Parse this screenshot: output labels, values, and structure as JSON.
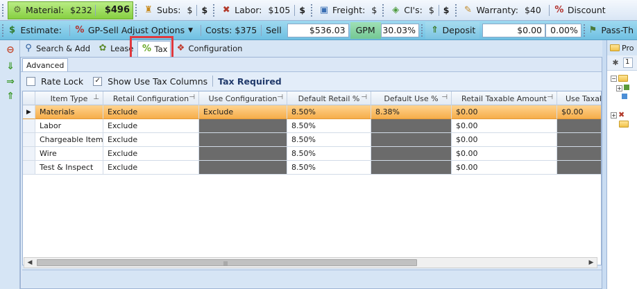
{
  "toolbar1": {
    "material": {
      "label": "Material:",
      "value": "$232",
      "total": "$496"
    },
    "subs": {
      "label": "Subs:",
      "value": "$",
      "total": "$"
    },
    "labor": {
      "label": "Labor:",
      "value": "$105",
      "total": "$"
    },
    "freight": {
      "label": "Freight:",
      "value": "$",
      "total": "$"
    },
    "cis": {
      "label": "CI's:",
      "value": "$",
      "total": "$"
    },
    "warranty": {
      "label": "Warranty:",
      "value": "$40"
    },
    "discount": {
      "label": "Discount"
    }
  },
  "toolbar2": {
    "estimate_label": "Estimate:",
    "gp_sell_label": "GP-Sell Adjust Options",
    "costs_label": "Costs: $375",
    "sell_label": "Sell",
    "sell_value": "$536.03",
    "gpm_label": "GPM",
    "gpm_value": "30.03%",
    "deposit_label": "Deposit",
    "deposit_value": "$0.00",
    "deposit_pct": "0.00%",
    "pass_through_label": "Pass-Th"
  },
  "tabs": [
    {
      "label": "Search & Add",
      "icon": "search-icon"
    },
    {
      "label": "Lease",
      "icon": "lease-icon"
    },
    {
      "label": "Tax",
      "icon": "percent-icon",
      "active": true
    },
    {
      "label": "Configuration",
      "icon": "configuration-icon"
    }
  ],
  "subtab": "Advanced",
  "options": {
    "rate_lock": {
      "label": "Rate Lock",
      "checked": false
    },
    "show_use_tax": {
      "label": "Show Use Tax Columns",
      "checked": true
    },
    "tax_required": "Tax Required"
  },
  "grid": {
    "columns": [
      "Item Type",
      "Retail Configuration",
      "Use Configuration",
      "Default Retail %",
      "Default Use %",
      "Retail Taxable Amount",
      "Use Taxab"
    ],
    "rows": [
      {
        "cells": [
          "Materials",
          "Exclude",
          "Exclude",
          "8.50%",
          "8.38%",
          "$0.00",
          "$0.00"
        ],
        "current": true
      },
      {
        "cells": [
          "Labor",
          "Exclude",
          "",
          "8.50%",
          "",
          "$0.00",
          ""
        ]
      },
      {
        "cells": [
          "Chargeable Items",
          "Exclude",
          "",
          "8.50%",
          "",
          "$0.00",
          ""
        ]
      },
      {
        "cells": [
          "Wire",
          "Exclude",
          "",
          "8.50%",
          "",
          "$0.00",
          ""
        ]
      },
      {
        "cells": [
          "Test & Inspect",
          "Exclude",
          "",
          "8.50%",
          "",
          "$0.00",
          ""
        ]
      }
    ]
  },
  "right_panel": {
    "tab_label": "Pro",
    "box_value": "1"
  },
  "colors": {
    "material_green": "#86cf41",
    "row_highlight": "#f6ad4a",
    "disabled_cell": "#6b6b6b",
    "annotation_red": "#e0393e"
  }
}
